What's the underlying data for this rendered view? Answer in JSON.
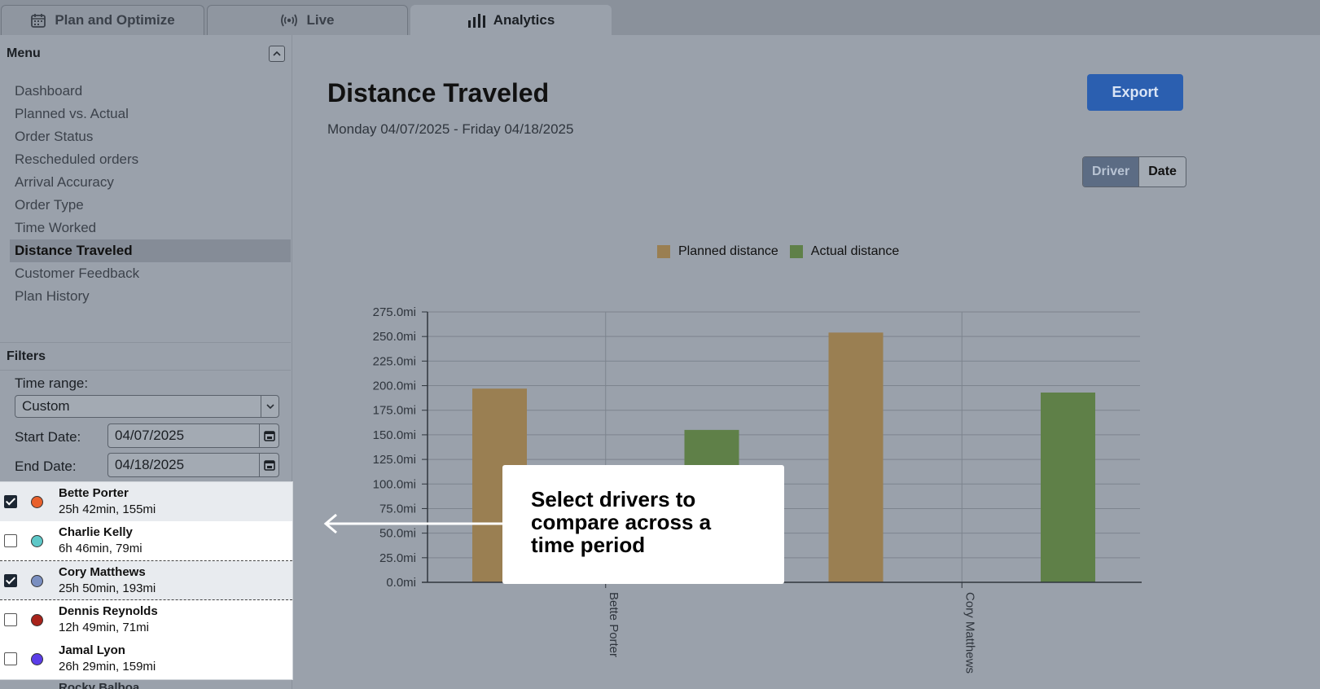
{
  "tabs": [
    {
      "label": "Plan and Optimize",
      "icon": "calendar-icon"
    },
    {
      "label": "Live",
      "icon": "broadcast-icon"
    },
    {
      "label": "Analytics",
      "icon": "bar-chart-icon",
      "active": true
    }
  ],
  "sidebar": {
    "menu_title": "Menu",
    "menu_items": [
      {
        "label": "Dashboard"
      },
      {
        "label": "Planned vs. Actual"
      },
      {
        "label": "Order Status"
      },
      {
        "label": "Rescheduled orders"
      },
      {
        "label": "Arrival Accuracy"
      },
      {
        "label": "Order Type"
      },
      {
        "label": "Time Worked"
      },
      {
        "label": "Distance Traveled",
        "active": true
      },
      {
        "label": "Customer Feedback"
      },
      {
        "label": "Plan History"
      }
    ],
    "filters_title": "Filters",
    "time_range_label": "Time range:",
    "time_range_value": "Custom",
    "start_date_label": "Start Date:",
    "start_date_value": "04/07/2025",
    "end_date_label": "End Date:",
    "end_date_value": "04/18/2025",
    "drivers": [
      {
        "name": "Bette Porter",
        "stats": "25h 42min, 155mi",
        "checked": true,
        "color": "#e8602c"
      },
      {
        "name": "Charlie Kelly",
        "stats": "6h 46min, 79mi",
        "checked": false,
        "color": "#5ec8c8"
      },
      {
        "name": "Cory Matthews",
        "stats": "25h 50min, 193mi",
        "checked": true,
        "color": "#7a8fc0"
      },
      {
        "name": "Dennis Reynolds",
        "stats": "12h 49min, 71mi",
        "checked": false,
        "color": "#a8231b"
      },
      {
        "name": "Jamal Lyon",
        "stats": "26h 29min, 159mi",
        "checked": false,
        "color": "#5b3de8"
      }
    ],
    "cut_off_driver": "Rocky Balboa"
  },
  "main": {
    "title": "Distance Traveled",
    "subtitle": "Monday 04/07/2025 - Friday 04/18/2025",
    "export_label": "Export",
    "toggle": {
      "driver": "Driver",
      "date": "Date",
      "active": "Driver"
    }
  },
  "callout": {
    "text": "Select drivers to compare across a time period"
  },
  "colors": {
    "planned": "#9a7f52",
    "actual": "#5f8048",
    "accent": "#2b5fb0"
  },
  "chart_data": {
    "type": "bar",
    "categories": [
      "Bette Porter",
      "Cory Matthews"
    ],
    "series": [
      {
        "name": "Planned distance",
        "values": [
          197,
          254
        ],
        "color": "#9a7f52"
      },
      {
        "name": "Actual distance",
        "values": [
          155,
          193
        ],
        "color": "#5f8048"
      }
    ],
    "ylim": [
      0,
      275
    ],
    "y_ticks": [
      0,
      25,
      50,
      75,
      100,
      125,
      150,
      175,
      200,
      225,
      250,
      275
    ],
    "y_unit": "mi",
    "grid": true,
    "legend_position": "top-center"
  }
}
